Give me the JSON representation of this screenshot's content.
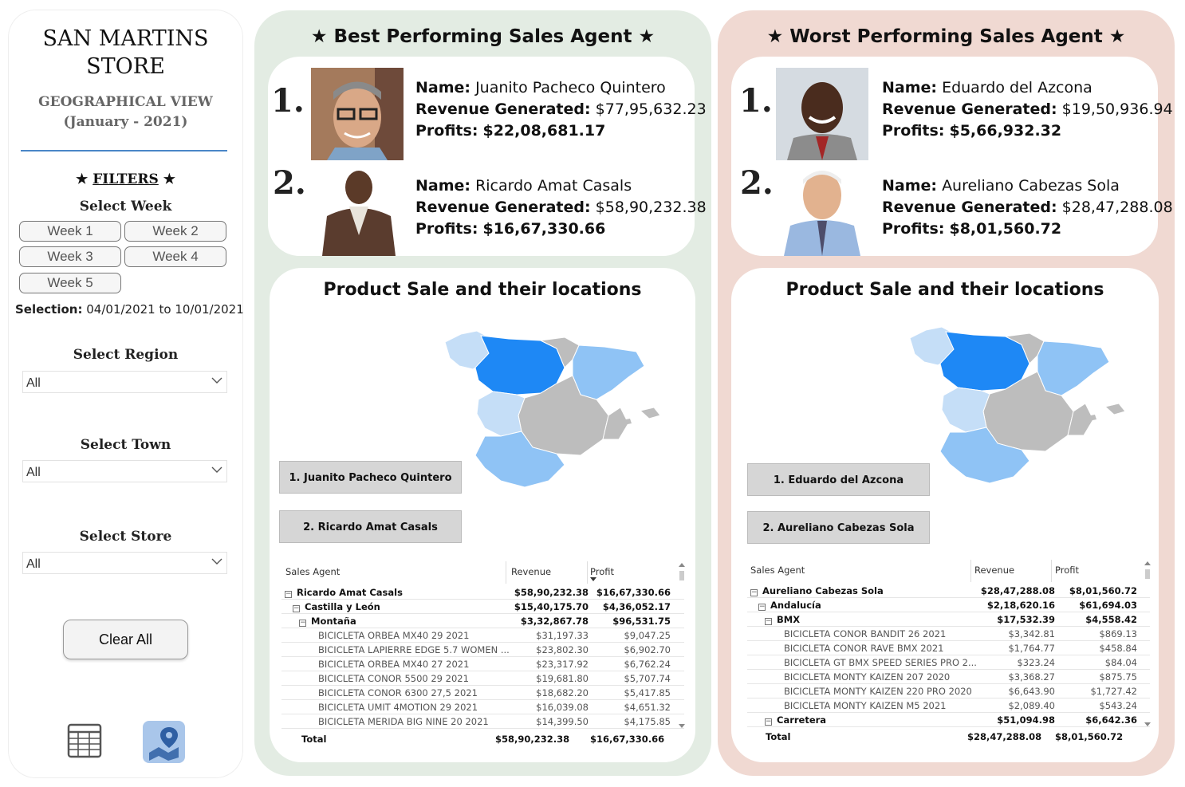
{
  "sidebar": {
    "store_title_line1": "SAN MARTINS",
    "store_title_line2": "STORE",
    "view_line1": "GEOGRAPHICAL VIEW",
    "view_line2": "(January - 2021)",
    "filters_label": "FILTERS",
    "star": "★",
    "select_week_label": "Select Week",
    "weeks": [
      "Week 1",
      "Week 2",
      "Week 3",
      "Week 4",
      "Week 5"
    ],
    "selection_label": "Selection:",
    "selection_value": "04/01/2021 to 10/01/2021",
    "select_region_label": "Select Region",
    "region_value": "All",
    "select_town_label": "Select Town",
    "town_value": "All",
    "select_store_label": "Select Store",
    "store_value": "All",
    "clear_all_label": "Clear All",
    "nav_icons": [
      "table-view-icon",
      "map-view-icon"
    ]
  },
  "best": {
    "title": "★ Best Performing Sales Agent ★",
    "agents": [
      {
        "rank": "1.",
        "name_label": "Name:",
        "name": "Juanito Pacheco Quintero",
        "revenue_label": "Revenue Generated:",
        "revenue": "$77,95,632.23",
        "profits_label": "Profits:",
        "profits": "$22,08,681.17"
      },
      {
        "rank": "2.",
        "name_label": "Name:",
        "name": "Ricardo Amat Casals",
        "revenue_label": "Revenue Generated:",
        "revenue": "$58,90,232.38",
        "profits_label": "Profits:",
        "profits": "$16,67,330.66"
      }
    ],
    "map_title": "Product Sale and their locations",
    "buttons": [
      "1. Juanito Pacheco Quintero",
      "2. Ricardo Amat Casals"
    ],
    "table": {
      "headers": [
        "Sales Agent",
        "Revenue",
        "Profit"
      ],
      "rows": [
        {
          "level": 0,
          "label": "Ricardo Amat Casals",
          "revenue": "$58,90,232.38",
          "profit": "$16,67,330.66"
        },
        {
          "level": 1,
          "label": "Castilla y León",
          "revenue": "$15,40,175.70",
          "profit": "$4,36,052.17"
        },
        {
          "level": 2,
          "label": "Montaña",
          "revenue": "$3,32,867.78",
          "profit": "$96,531.75"
        },
        {
          "level": 3,
          "label": "BICICLETA ORBEA MX40 29 2021",
          "revenue": "$31,197.33",
          "profit": "$9,047.25"
        },
        {
          "level": 3,
          "label": "BICICLETA LAPIERRE EDGE 5.7 WOMEN ...",
          "revenue": "$23,802.30",
          "profit": "$6,902.70"
        },
        {
          "level": 3,
          "label": "BICICLETA ORBEA MX40 27 2021",
          "revenue": "$23,317.92",
          "profit": "$6,762.24"
        },
        {
          "level": 3,
          "label": "BICICLETA CONOR 5500 29 2021",
          "revenue": "$19,681.80",
          "profit": "$5,707.74"
        },
        {
          "level": 3,
          "label": "BICICLETA CONOR 6300 27,5 2021",
          "revenue": "$18,682.20",
          "profit": "$5,417.85"
        },
        {
          "level": 3,
          "label": "BICICLETA UMIT 4MOTION 29 2021",
          "revenue": "$16,039.08",
          "profit": "$4,651.32"
        },
        {
          "level": 3,
          "label": "BICICLETA MERIDA BIG NINE 20 2021",
          "revenue": "$14,399.50",
          "profit": "$4,175.85"
        }
      ],
      "total_label": "Total",
      "total_revenue": "$58,90,232.38",
      "total_profit": "$16,67,330.66"
    }
  },
  "worst": {
    "title": "★ Worst Performing Sales Agent ★",
    "agents": [
      {
        "rank": "1.",
        "name_label": "Name:",
        "name": "Eduardo del Azcona",
        "revenue_label": "Revenue Generated:",
        "revenue": "$19,50,936.94",
        "profits_label": "Profits:",
        "profits": "$5,66,932.32"
      },
      {
        "rank": "2.",
        "name_label": "Name:",
        "name": "Aureliano Cabezas Sola",
        "revenue_label": "Revenue Generated:",
        "revenue": "$28,47,288.08",
        "profits_label": "Profits:",
        "profits": "$8,01,560.72"
      }
    ],
    "map_title": "Product Sale and their locations",
    "buttons": [
      "1. Eduardo del Azcona",
      "2. Aureliano Cabezas Sola"
    ],
    "table": {
      "headers": [
        "Sales Agent",
        "Revenue",
        "Profit"
      ],
      "rows": [
        {
          "level": 0,
          "label": "Aureliano Cabezas Sola",
          "revenue": "$28,47,288.08",
          "profit": "$8,01,560.72"
        },
        {
          "level": 1,
          "label": "Andalucía",
          "revenue": "$2,18,620.16",
          "profit": "$61,694.03"
        },
        {
          "level": 2,
          "label": "BMX",
          "revenue": "$17,532.39",
          "profit": "$4,558.42"
        },
        {
          "level": 3,
          "label": "BICICLETA CONOR BANDIT 26 2021",
          "revenue": "$3,342.81",
          "profit": "$869.13"
        },
        {
          "level": 3,
          "label": "BICICLETA CONOR RAVE BMX 2021",
          "revenue": "$1,764.77",
          "profit": "$458.84"
        },
        {
          "level": 3,
          "label": "BICICLETA GT BMX SPEED SERIES PRO 2...",
          "revenue": "$323.24",
          "profit": "$84.04"
        },
        {
          "level": 3,
          "label": "BICICLETA MONTY KAIZEN 207 2020",
          "revenue": "$3,368.27",
          "profit": "$875.75"
        },
        {
          "level": 3,
          "label": "BICICLETA MONTY KAIZEN 220 PRO 2020",
          "revenue": "$6,643.90",
          "profit": "$1,727.42"
        },
        {
          "level": 3,
          "label": "BICICLETA MONTY KAIZEN M5 2021",
          "revenue": "$2,089.40",
          "profit": "$543.24"
        },
        {
          "level": 2,
          "label": "Carretera",
          "revenue": "$51,094.98",
          "profit": "$6,642.36"
        }
      ],
      "total_label": "Total",
      "total_revenue": "$28,47,288.08",
      "total_profit": "$8,01,560.72"
    }
  },
  "colors": {
    "best_bg": "#e3ece3",
    "worst_bg": "#f0d9d2",
    "map_dark_blue": "#1e88f5",
    "map_light_blue": "#8fc3f5",
    "map_pale_blue": "#c5def7",
    "map_gray": "#bdbdbd"
  }
}
